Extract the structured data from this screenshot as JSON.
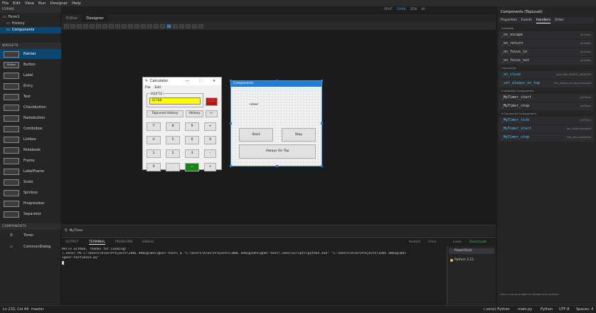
{
  "menubar": [
    "File",
    "Edit",
    "View",
    "Run",
    "Designer",
    "Help"
  ],
  "topbar": {
    "labels": [
      "SPLIT",
      "DARK",
      "ZEN",
      "40"
    ]
  },
  "left": {
    "forms_header": "FORMS",
    "tree": [
      {
        "label": "Form1"
      },
      {
        "label": "History"
      },
      {
        "label": "Components"
      }
    ],
    "widgets_header": "WIDGETS",
    "widgets": [
      {
        "label": "Pointer",
        "thumb": ""
      },
      {
        "label": "Button",
        "thumb": "Button"
      },
      {
        "label": "Label",
        "thumb": ""
      },
      {
        "label": "Entry",
        "thumb": ""
      },
      {
        "label": "Text",
        "thumb": ""
      },
      {
        "label": "Checkbutton",
        "thumb": ""
      },
      {
        "label": "Radiobutton",
        "thumb": ""
      },
      {
        "label": "Combobox",
        "thumb": ""
      },
      {
        "label": "Listbox",
        "thumb": ""
      },
      {
        "label": "Notebook",
        "thumb": ""
      },
      {
        "label": "Frame",
        "thumb": ""
      },
      {
        "label": "LabelFrame",
        "thumb": ""
      },
      {
        "label": "Scale",
        "thumb": ""
      },
      {
        "label": "Spinbox",
        "thumb": ""
      },
      {
        "label": "Progressbar",
        "thumb": ""
      },
      {
        "label": "Separator",
        "thumb": ""
      }
    ],
    "components_header": "COMPONENTS",
    "components": [
      {
        "label": "Timer"
      },
      {
        "label": "CommonDialog"
      }
    ]
  },
  "editor_tabs": [
    "Editor",
    "Designer"
  ],
  "calculator": {
    "title": "Calculator",
    "menu": [
      "File",
      "Edit"
    ],
    "group_label": "1024*32",
    "display": "32768",
    "clear": "C/CE",
    "row2": [
      "TopLevel History",
      "History",
      "<-"
    ],
    "rows": [
      [
        "7",
        "8",
        "9",
        "+"
      ],
      [
        "4",
        "5",
        "6",
        "X"
      ],
      [
        "1",
        "2",
        "3",
        "-"
      ],
      [
        "0",
        ".",
        "=",
        "+"
      ]
    ]
  },
  "components_window": {
    "title": "Components",
    "timer_label": "Timer:",
    "start": "Start",
    "stop": "Stop",
    "always_on_top": "Always On Top"
  },
  "mytimer": {
    "label": "MyTimer"
  },
  "terminal": {
    "tabs": [
      "OUTPUT",
      "TERMINAL",
      "PROBLEMS",
      "DEBUG"
    ],
    "actions": [
      "Restart",
      "Clear",
      "Lines",
      "Deactivate"
    ],
    "lines": [
      "Hello GitHub, Thanks for Looking!",
      "(.venv) PS C:\\Users\\Alex\\Projects\\IDOL debug\\Designer-test> & \"C:\\Users\\Alex\\Projects\\IDOL debug\\Designer-test\\.venv\\Scripts\\python.exe\" \"C:\\Users\\Alex\\Projects\\IDOL debug\\Des",
      "igner-test\\main.py\""
    ],
    "sessions": [
      "PowerShell",
      "Python 3.12"
    ]
  },
  "right": {
    "title": "Components (TopLevel)",
    "tabs": [
      "Properties",
      "Events",
      "Handlers",
      "Order"
    ],
    "available_label": "Available",
    "available": [
      {
        "name": "_on_escape",
        "note": "all items"
      },
      {
        "name": "_on_return",
        "note": "all items"
      },
      {
        "name": "_on_focus_in",
        "note": "all items"
      },
      {
        "name": "_on_focus_out",
        "note": "all items"
      }
    ],
    "connected_label": "Connected",
    "connected": [
      {
        "name": "_on_close",
        "note": "bind_WM_DELETE_WINDOW"
      },
      {
        "name": "_set_always_on_top",
        "note": "btn_always_on_top.command"
      }
    ],
    "avail_comp_label": "▾ Available Components",
    "avail_comp": [
      {
        "name": "_MyTimer_start",
        "note": "myTimer"
      },
      {
        "name": "_MyTimer_stop",
        "note": "myTimer"
      }
    ],
    "conn_comp_label": "▾ Connected Components",
    "conn_comp": [
      {
        "name": "_MyTimer_tick",
        "note": "myTimer"
      },
      {
        "name": "_MyTimer_start",
        "note": "btn_start.command"
      },
      {
        "name": "_MyTimer_stop",
        "note": "btn_stop.command"
      }
    ],
    "hint": "Click a row to enable or disable this handler"
  },
  "status": {
    "left": [
      "Ln 232, Col 44",
      "master"
    ],
    "right": [
      "(.venv) Python",
      "main.py",
      "Python",
      "UTF-8",
      "Spaces: 4"
    ]
  },
  "colors": {
    "accent": "#1f7fd6",
    "selection": "#094771",
    "display_bg": "#ffff00",
    "clear_bg": "#c01010",
    "equals_bg": "#118811"
  }
}
